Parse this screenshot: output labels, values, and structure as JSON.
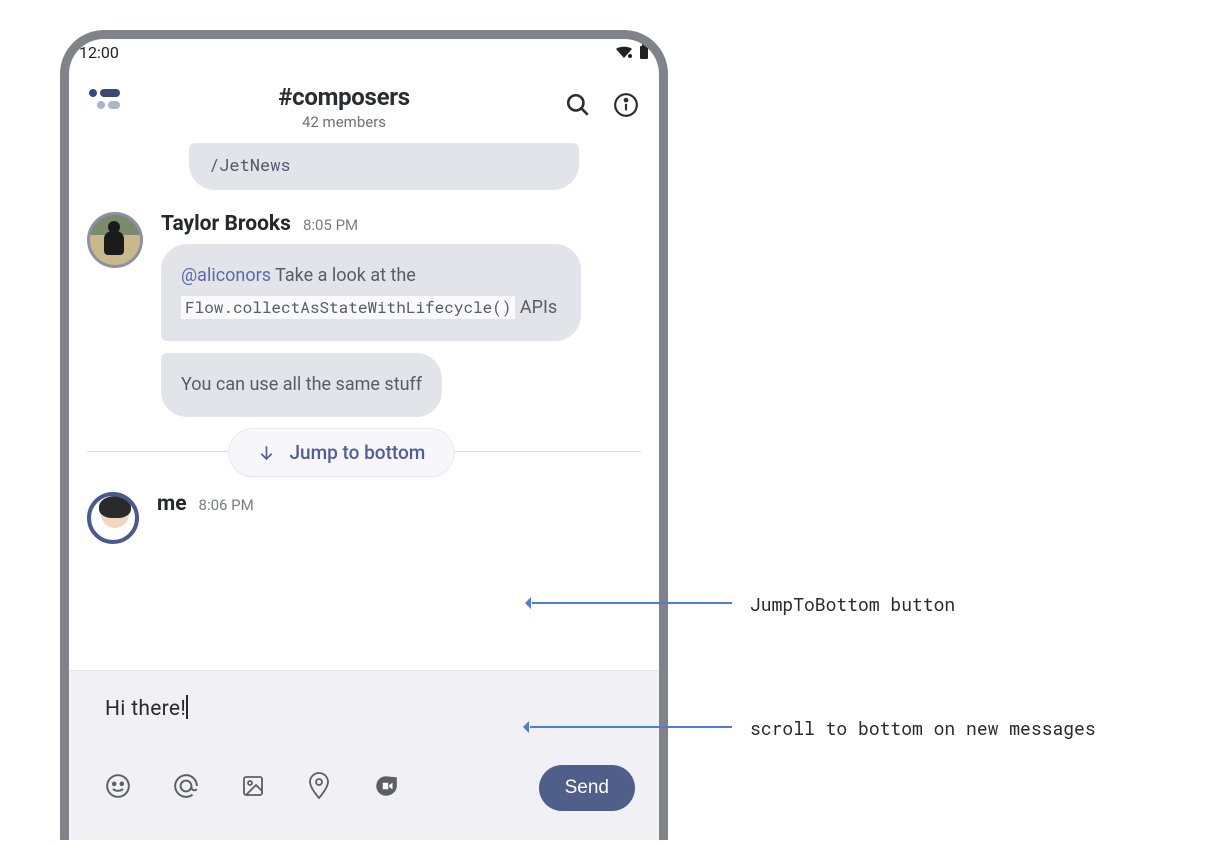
{
  "status": {
    "time": "12:00"
  },
  "header": {
    "channel": "#composers",
    "members": "42 members"
  },
  "messages": {
    "topFragment": "/JetNews",
    "taylor": {
      "name": "Taylor Brooks",
      "time": "8:05 PM",
      "bubble1_mention": "@aliconors",
      "bubble1_before": " Take a look at the ",
      "bubble1_code": "Flow.collectAsStateWithLifecycle()",
      "bubble1_after": " APIs",
      "bubble2": "You can use all the same stuff"
    },
    "jump": "Jump to bottom",
    "me": {
      "name": "me",
      "time": "8:06 PM"
    }
  },
  "composer": {
    "value": "Hi there!",
    "send": "Send"
  },
  "annotations": {
    "jump": "JumpToBottom button",
    "scroll": "scroll to bottom on new messages"
  }
}
